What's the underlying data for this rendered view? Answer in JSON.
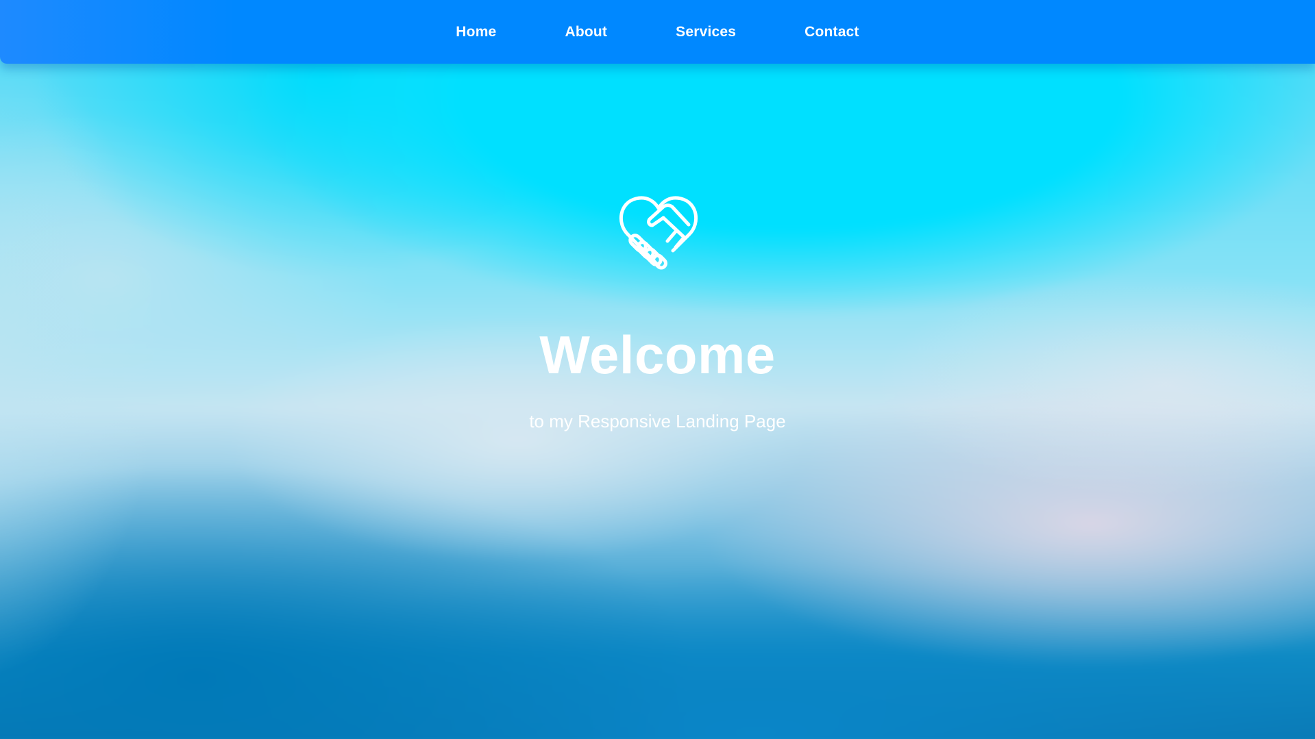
{
  "nav": {
    "items": [
      {
        "label": "Home"
      },
      {
        "label": "About"
      },
      {
        "label": "Services"
      },
      {
        "label": "Contact"
      }
    ]
  },
  "hero": {
    "icon": "heart-handshake-icon",
    "title": "Welcome",
    "subtitle": "to my Responsive Landing Page"
  },
  "colors": {
    "navbar": "#0088ff",
    "text": "#ffffff",
    "background_top": "#00e0ff",
    "background_bottom": "#0a78b4"
  }
}
